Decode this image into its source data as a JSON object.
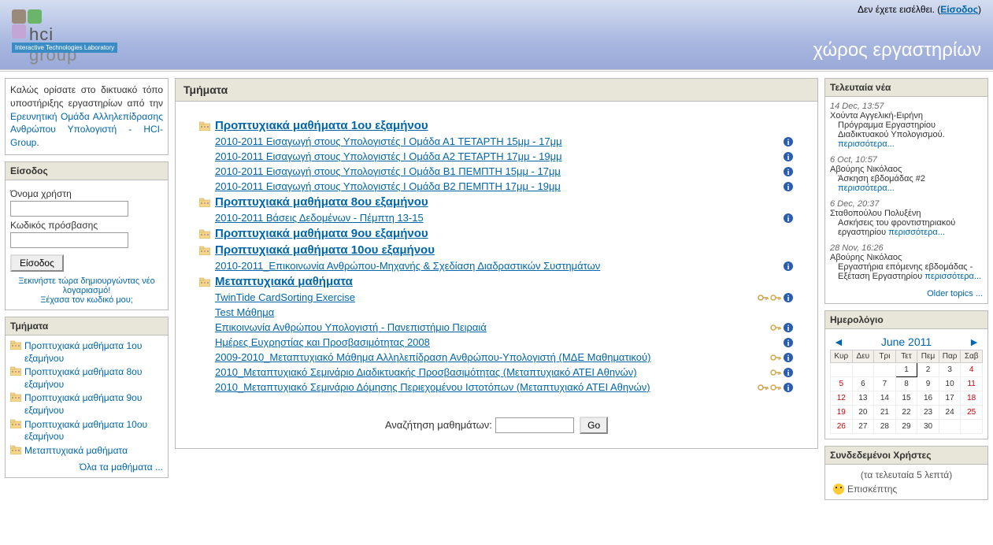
{
  "header": {
    "logo_main": "hcigroup",
    "logo_sub": "Interactive Technologies Laboratory",
    "login_status": "Δεν έχετε εισέλθει. (",
    "login_link": "Είσοδος",
    "login_status_close": ")",
    "site_title": "χώρος εργαστηρίων"
  },
  "welcome": {
    "text_before": "Καλώς ορίσατε στο δικτυακό τόπο υποστήριξης εργαστηρίων από την ",
    "link": "Ερευνητική Ομάδα Αλληλεπίδρασης Ανθρώπου Υπολογιστή - HCI-Group",
    "text_after": "."
  },
  "login_block": {
    "title": "Είσοδος",
    "username_label": "Όνομα χρήστη",
    "password_label": "Κωδικός πρόσβασης",
    "button": "Είσοδος",
    "signup_link": "Ξεκινήστε τώρα δημιουργώντας νέο λογαριασμό!",
    "forgot_link": "Ξέχασα τον κωδικό μου;"
  },
  "dept_block": {
    "title": "Τμήματα",
    "items": [
      "Προπτυχιακά μαθήματα 1ου εξαμήνου",
      "Προπτυχιακά μαθήματα 8ου εξαμήνου",
      "Προπτυχιακά μαθήματα 9ου εξαμήνου",
      "Προπτυχιακά μαθήματα 10ου εξαμήνου",
      "Μεταπτυχιακά μαθήματα"
    ],
    "all_courses": "Όλα τα μαθήματα ..."
  },
  "main": {
    "title": "Τμήματα",
    "categories": [
      {
        "name": "Προπτυχιακά μαθήματα 1ου εξαμήνου",
        "courses": [
          {
            "name": "2010-2011 Εισαγωγή στους Υπολογιστές I Ομάδα Α1 ΤΕΤΑΡΤΗ 15μμ - 17μμ",
            "info": true
          },
          {
            "name": "2010-2011 Εισαγωγή στους Υπολογιστές I Ομάδα Α2 ΤΕΤΑΡΤΗ 17μμ - 19μμ",
            "info": true
          },
          {
            "name": "2010-2011 Εισαγωγή στους Υπολογιστές I Ομάδα Β1 ΠΕΜΠΤΗ 15μμ - 17μμ",
            "info": true
          },
          {
            "name": "2010-2011 Εισαγωγή στους Υπολογιστές I Ομάδα Β2 ΠΕΜΠΤΗ 17μμ - 19μμ",
            "info": true
          }
        ]
      },
      {
        "name": "Προπτυχιακά μαθήματα 8ου εξαμήνου",
        "courses": [
          {
            "name": "2010-2011 Βάσεις Δεδομένων - Πέμπτη 13-15",
            "info": true
          }
        ]
      },
      {
        "name": "Προπτυχιακά μαθήματα 9ου εξαμήνου",
        "courses": []
      },
      {
        "name": "Προπτυχιακά μαθήματα 10ου εξαμήνου",
        "courses": [
          {
            "name": "2010-2011_Επικοινωνία Ανθρώπου-Μηχανής & Σχεδίαση Διαδραστικών Συστημάτων",
            "info": true
          }
        ]
      },
      {
        "name": "Μεταπτυχιακά μαθήματα",
        "courses": [
          {
            "name": "TwinTide CardSorting Exercise",
            "key": true,
            "key2": true,
            "info": true
          },
          {
            "name": "Test Μάθημα"
          },
          {
            "name": "Επικοινωνία Ανθρώπου Υπολογιστή - Πανεπιστήμιο Πειραιά",
            "key2": true,
            "info": true
          },
          {
            "name": "Ημέρες Ευχρηστίας και Προσβασιμότητας 2008",
            "info": true
          },
          {
            "name": "2009-2010_Μεταπτυχιακό Μάθημα Αλληλεπίδραση Ανθρώπου-Υπολογιστή (ΜΔΕ Μαθηματικού)",
            "key2": true,
            "info": true
          },
          {
            "name": "2010_Μεταπτυχιακό Σεμινάριο Διαδικτυακής Προσβασιμότητας (Μεταπτυχιακό ΑΤΕΙ Αθηνών)",
            "key2": true,
            "info": true
          },
          {
            "name": "2010_Μεταπτυχιακό Σεμινάριο Δόμησης Περιεχομένου Ιστοτόπων (Μεταπτυχιακό ΑΤΕΙ Αθηνών)",
            "key": true,
            "key2": true,
            "info": true
          }
        ]
      }
    ],
    "search_label": "Αναζήτηση μαθημάτων:",
    "search_button": "Go"
  },
  "news": {
    "title": "Τελευταία νέα",
    "items": [
      {
        "date": "14 Dec, 13:57",
        "author": "Χούντα Αγγελική-Ειρήνη",
        "subject": "Πρόγραμμα Εργαστηρίου Διαδικτυακού Υπολογισμού.",
        "more": "περισσότερα..."
      },
      {
        "date": "6 Oct, 10:57",
        "author": "Αβούρης Νικόλαος",
        "subject": "Άσκηση εβδομάδας #2",
        "more": "περισσότερα..."
      },
      {
        "date": "6 Dec, 20:37",
        "author": "Σταθοπούλου Πολυξένη",
        "subject": "Ασκήσεις του φροντιστηριακού εργαστηρίου",
        "more": "περισσότερα..."
      },
      {
        "date": "28 Nov, 16:26",
        "author": "Αβούρης Νικόλαος",
        "subject": "Εργαστήρια επόμενης εβδομάδας - Εξέταση Εργαστηρίου",
        "more": "περισσότερα..."
      }
    ],
    "older": "Older topics ..."
  },
  "calendar": {
    "title": "Ημερολόγιο",
    "prev": "◄",
    "next": "►",
    "month": "June 2011",
    "days": [
      "Κυρ",
      "Δευ",
      "Τρι",
      "Τετ",
      "Πεμ",
      "Παρ",
      "Σαβ"
    ],
    "weeks": [
      [
        "",
        "",
        "",
        "1",
        "2",
        "3",
        "4"
      ],
      [
        "5",
        "6",
        "7",
        "8",
        "9",
        "10",
        "11"
      ],
      [
        "12",
        "13",
        "14",
        "15",
        "16",
        "17",
        "18"
      ],
      [
        "19",
        "20",
        "21",
        "22",
        "23",
        "24",
        "25"
      ],
      [
        "26",
        "27",
        "28",
        "29",
        "30",
        "",
        ""
      ]
    ],
    "today": "1"
  },
  "online": {
    "title": "Συνδεδεμένοι Χρήστες",
    "subtitle": "(τα τελευταία 5 λεπτά)",
    "visitor": "Επισκέπτης"
  }
}
